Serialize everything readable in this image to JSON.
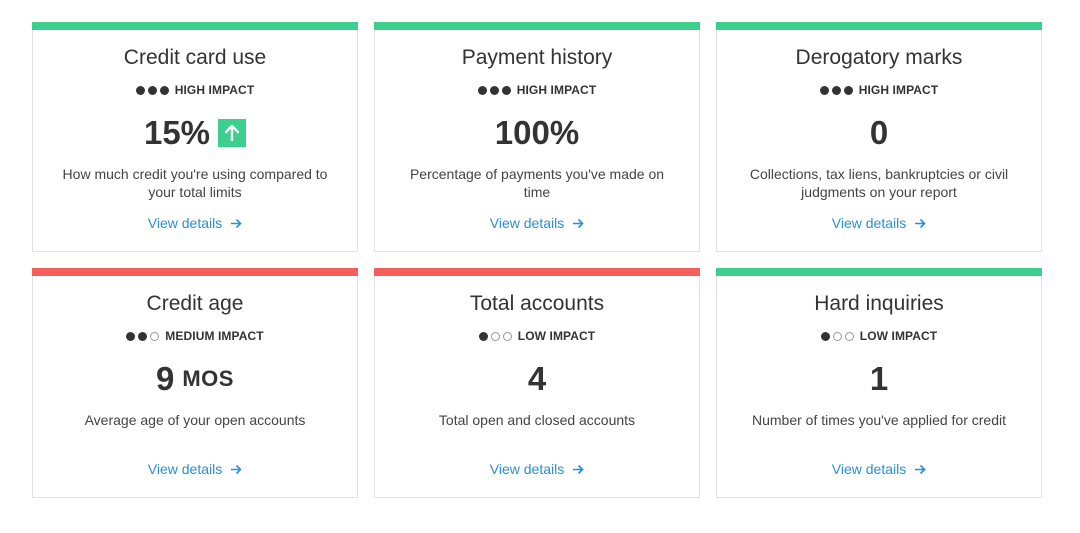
{
  "colors": {
    "good": "#3ccf8e",
    "bad": "#f45f5a",
    "link": "#2a8fd6"
  },
  "cards": [
    {
      "title": "Credit card use",
      "status": "good",
      "impact_level": 3,
      "impact": "HIGH IMPACT",
      "value": "15%",
      "unit": "",
      "trend": "up-arrow-icon",
      "description": "How much credit you're using compared to your total limits",
      "link": "View details"
    },
    {
      "title": "Payment history",
      "status": "good",
      "impact_level": 3,
      "impact": "HIGH IMPACT",
      "value": "100%",
      "unit": "",
      "description": "Percentage of payments you've made on time",
      "link": "View details"
    },
    {
      "title": "Derogatory marks",
      "status": "good",
      "impact_level": 3,
      "impact": "HIGH IMPACT",
      "value": "0",
      "unit": "",
      "description": "Collections, tax liens, bankruptcies or civil judgments on your report",
      "link": "View details"
    },
    {
      "title": "Credit age",
      "status": "bad",
      "impact_level": 2,
      "impact": "MEDIUM IMPACT",
      "value": "9",
      "unit": "MOS",
      "description": "Average age of your open accounts",
      "link": "View details"
    },
    {
      "title": "Total accounts",
      "status": "bad",
      "impact_level": 1,
      "impact": "LOW IMPACT",
      "value": "4",
      "unit": "",
      "description": "Total open and closed accounts",
      "link": "View details"
    },
    {
      "title": "Hard inquiries",
      "status": "good",
      "impact_level": 1,
      "impact": "LOW IMPACT",
      "value": "1",
      "unit": "",
      "description": "Number of times you've applied for credit",
      "link": "View details"
    }
  ]
}
